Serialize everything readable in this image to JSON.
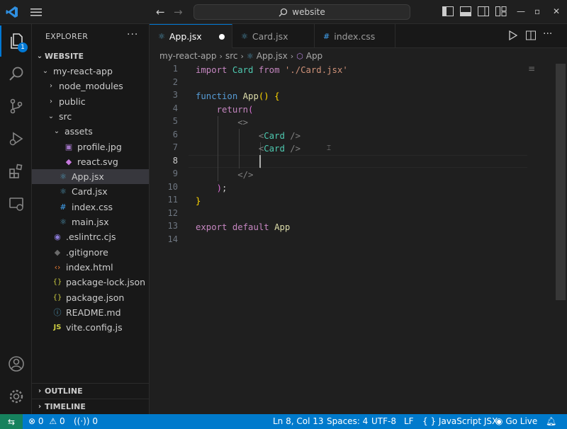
{
  "titlebar": {
    "search_text": "website",
    "back_glyph": "←",
    "forward_glyph": "→",
    "window_buttons": [
      "—",
      "▫",
      "✕"
    ]
  },
  "activitybar": {
    "explorer_badge": "1",
    "items": [
      "files-icon",
      "search-icon",
      "source-control-icon",
      "run-debug-icon",
      "extensions-icon",
      "remote-explorer-icon",
      "account-icon",
      "manage-gear-icon"
    ]
  },
  "sidebar": {
    "title": "EXPLORER",
    "more": "···",
    "root": "WEBSITE",
    "tree": [
      {
        "label": "my-react-app",
        "type": "folder-open",
        "indent": 1
      },
      {
        "label": "node_modules",
        "type": "folder-closed",
        "indent": 2
      },
      {
        "label": "public",
        "type": "folder-closed",
        "indent": 2
      },
      {
        "label": "src",
        "type": "folder-open",
        "indent": 2
      },
      {
        "label": "assets",
        "type": "folder-open",
        "indent": 3
      },
      {
        "label": "profile.jpg",
        "type": "image",
        "indent": 4
      },
      {
        "label": "react.svg",
        "type": "svg",
        "indent": 4
      },
      {
        "label": "App.jsx",
        "type": "react",
        "indent": 3,
        "selected": true
      },
      {
        "label": "Card.jsx",
        "type": "react",
        "indent": 3
      },
      {
        "label": "index.css",
        "type": "css",
        "indent": 3
      },
      {
        "label": "main.jsx",
        "type": "react",
        "indent": 3
      },
      {
        "label": ".eslintrc.cjs",
        "type": "eslint",
        "indent": 2
      },
      {
        "label": ".gitignore",
        "type": "git",
        "indent": 2
      },
      {
        "label": "index.html",
        "type": "html",
        "indent": 2
      },
      {
        "label": "package-lock.json",
        "type": "json",
        "indent": 2
      },
      {
        "label": "package.json",
        "type": "json",
        "indent": 2
      },
      {
        "label": "README.md",
        "type": "info",
        "indent": 2
      },
      {
        "label": "vite.config.js",
        "type": "js",
        "indent": 2
      }
    ],
    "outline_label": "OUTLINE",
    "timeline_label": "TIMELINE"
  },
  "tabs": [
    {
      "label": "App.jsx",
      "icon": "⚛",
      "active": true,
      "dirty": true
    },
    {
      "label": "Card.jsx",
      "icon": "⚛",
      "active": false
    },
    {
      "label": "index.css",
      "icon": "#",
      "active": false
    }
  ],
  "breadcrumb": {
    "parts": [
      "my-react-app",
      "src",
      "App.jsx",
      "App"
    ]
  },
  "editor": {
    "line_numbers": [
      "1",
      "2",
      "3",
      "4",
      "5",
      "6",
      "7",
      "8",
      "9",
      "10",
      "11",
      "12",
      "13",
      "14"
    ],
    "active_line": 8,
    "lines": [
      [
        {
          "t": "import ",
          "c": "kw"
        },
        {
          "t": "Card ",
          "c": "cls"
        },
        {
          "t": "from ",
          "c": "kw"
        },
        {
          "t": "'./Card.jsx'",
          "c": "str"
        }
      ],
      [],
      [
        {
          "t": "function ",
          "c": "kwb"
        },
        {
          "t": "App",
          "c": "fn"
        },
        {
          "t": "() ",
          "c": "br"
        },
        {
          "t": "{",
          "c": "br"
        }
      ],
      [
        {
          "t": "    return",
          "c": "kw"
        },
        {
          "t": "(",
          "c": "br2"
        }
      ],
      [
        {
          "t": "        <>",
          "c": "punc"
        }
      ],
      [
        {
          "t": "            <",
          "c": "punc"
        },
        {
          "t": "Card ",
          "c": "cls"
        },
        {
          "t": "/>",
          "c": "punc"
        }
      ],
      [
        {
          "t": "            <",
          "c": "punc"
        },
        {
          "t": "Card ",
          "c": "cls"
        },
        {
          "t": "/>",
          "c": "punc"
        }
      ],
      [],
      [
        {
          "t": "        </>",
          "c": "punc"
        }
      ],
      [
        {
          "t": "    ",
          "c": "plain"
        },
        {
          "t": ")",
          "c": "br2"
        },
        {
          "t": ";",
          "c": "plain"
        }
      ],
      [
        {
          "t": "}",
          "c": "br"
        }
      ],
      [],
      [
        {
          "t": "export ",
          "c": "kw"
        },
        {
          "t": "default ",
          "c": "kw"
        },
        {
          "t": "App",
          "c": "fn"
        }
      ],
      []
    ]
  },
  "statusbar": {
    "remote": "⇆",
    "errors": "0",
    "warnings": "0",
    "ports": "0",
    "position": "Ln 8, Col 13",
    "spaces": "Spaces: 4",
    "encoding": "UTF-8",
    "eol": "LF",
    "language": "JavaScript JSX",
    "golive": "Go Live"
  },
  "colors": {
    "accent": "#0078d4",
    "statusbar": "#007acc",
    "remote": "#16825d"
  }
}
